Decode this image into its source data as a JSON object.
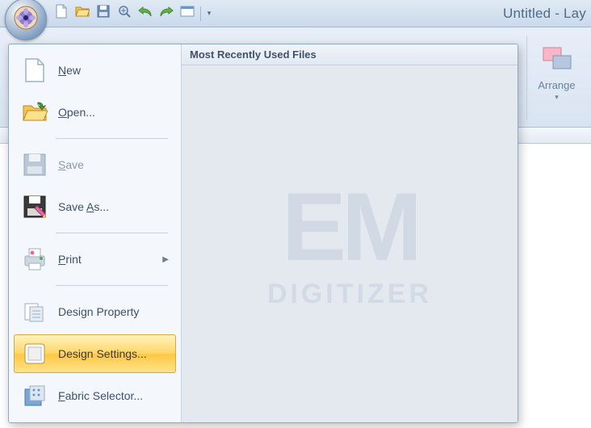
{
  "window": {
    "title": "Untitled - Lay"
  },
  "qat": {
    "items": [
      "new-file-icon",
      "open-folder-icon",
      "save-icon",
      "zoom-in-icon",
      "undo-icon",
      "redo-icon",
      "window-icon"
    ]
  },
  "ribbon": {
    "arrange": {
      "label": "Arrange"
    }
  },
  "app_menu": {
    "items": [
      {
        "key": "new",
        "label_pre": "",
        "label_u": "N",
        "label_post": "ew",
        "muted": false,
        "has_sub": false
      },
      {
        "key": "open",
        "label_pre": "",
        "label_u": "O",
        "label_post": "pen...",
        "muted": false,
        "has_sub": false
      },
      {
        "key": "save",
        "label_pre": "",
        "label_u": "S",
        "label_post": "ave",
        "muted": true,
        "has_sub": false
      },
      {
        "key": "save_as",
        "label_pre": "Save ",
        "label_u": "A",
        "label_post": "s...",
        "muted": false,
        "has_sub": false
      },
      {
        "key": "print",
        "label_pre": "",
        "label_u": "P",
        "label_post": "rint",
        "muted": false,
        "has_sub": true
      },
      {
        "key": "design_property",
        "label_pre": "Design Property",
        "label_u": "",
        "label_post": "",
        "muted": false,
        "has_sub": false
      },
      {
        "key": "design_settings",
        "label_pre": "Design Settings...",
        "label_u": "",
        "label_post": "",
        "muted": false,
        "has_sub": false,
        "selected": true
      },
      {
        "key": "fabric_selector",
        "label_pre": "",
        "label_u": "F",
        "label_post": "abric Selector...",
        "muted": false,
        "has_sub": false
      }
    ],
    "right_header": "Most Recently Used Files"
  },
  "watermark": {
    "line1": "EM",
    "line2": "DIGITIZER"
  }
}
